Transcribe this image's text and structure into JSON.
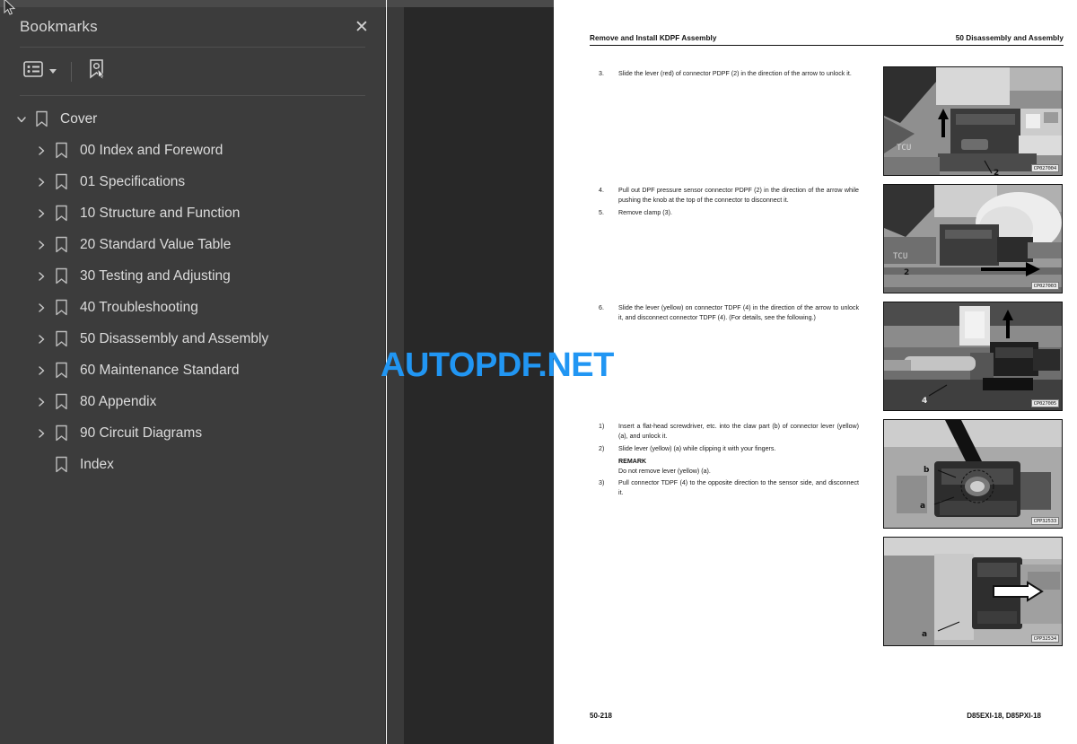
{
  "sidebar": {
    "title": "Bookmarks",
    "close_label": "✕",
    "toolbar": {
      "options_icon": "list-options-icon",
      "expand_caret": "chevron-down-icon",
      "new_bookmark_icon": "new-bookmark-icon"
    },
    "tree": [
      {
        "label": "Cover",
        "level": 0,
        "expanded": true,
        "has_children": true
      },
      {
        "label": "00 Index and Foreword",
        "level": 1,
        "expanded": false,
        "has_children": true
      },
      {
        "label": "01 Specifications",
        "level": 1,
        "expanded": false,
        "has_children": true
      },
      {
        "label": "10 Structure and Function",
        "level": 1,
        "expanded": false,
        "has_children": true
      },
      {
        "label": "20 Standard Value Table",
        "level": 1,
        "expanded": false,
        "has_children": true
      },
      {
        "label": "30 Testing and Adjusting",
        "level": 1,
        "expanded": false,
        "has_children": true
      },
      {
        "label": "40 Troubleshooting",
        "level": 1,
        "expanded": false,
        "has_children": true
      },
      {
        "label": "50 Disassembly and Assembly",
        "level": 1,
        "expanded": false,
        "has_children": true
      },
      {
        "label": "60 Maintenance Standard",
        "level": 1,
        "expanded": false,
        "has_children": true
      },
      {
        "label": "80 Appendix",
        "level": 1,
        "expanded": false,
        "has_children": true
      },
      {
        "label": "90 Circuit Diagrams",
        "level": 1,
        "expanded": false,
        "has_children": true
      },
      {
        "label": "Index",
        "level": 1,
        "expanded": false,
        "has_children": false
      }
    ]
  },
  "watermark": {
    "text": "AUTOPDF.NET",
    "color": "#2196f3"
  },
  "document": {
    "header": {
      "left": "Remove and Install KDPF Assembly",
      "right": "50 Disassembly and Assembly"
    },
    "footer": {
      "left": "50-218",
      "right": "D85EXI-18, D85PXI-18"
    },
    "blocks": [
      {
        "id": "step-3",
        "steps": [
          {
            "num": "3.",
            "text": "Slide the lever (red) of connector PDPF (2) in the direction of the arrow to unlock it."
          }
        ]
      },
      {
        "id": "step-4-5",
        "steps": [
          {
            "num": "4.",
            "text": "Pull out DPF pressure sensor connector PDPF (2) in the direction of the arrow while pushing the knob at the top of the connector to disconnect it."
          },
          {
            "num": "5.",
            "text": "Remove clamp (3)."
          }
        ]
      },
      {
        "id": "step-6",
        "steps": [
          {
            "num": "6.",
            "text": "Slide the lever (yellow) on connector TDPF (4) in the direction of the arrow to unlock it, and disconnect connector TDPF (4). (For details, see the following.)"
          }
        ]
      },
      {
        "id": "step-sub",
        "steps": [
          {
            "num": "1)",
            "text": "Insert a flat-head screwdriver, etc. into the claw part (b) of connector lever (yellow) (a), and unlock it."
          },
          {
            "num": "2)",
            "text": "Slide lever (yellow) (a) while clipping it with your fingers."
          }
        ],
        "remark_title": "REMARK",
        "remark_body": "Do not remove lever (yellow) (a).",
        "steps_after": [
          {
            "num": "3)",
            "text": "Pull connector TDPF (4) to the opposite direction to the sensor side, and disconnect it."
          }
        ]
      }
    ],
    "figures": [
      {
        "code": "CP027004",
        "alt": "photo-connector-pdpf-lever"
      },
      {
        "code": "CP027003",
        "alt": "photo-pull-out-pdpf-connector"
      },
      {
        "code": "CP027005",
        "alt": "photo-connector-tdpf-lever"
      },
      {
        "code": "CPP32533",
        "alt": "photo-screwdriver-claw-part"
      },
      {
        "code": "CPP32534",
        "alt": "photo-pull-connector-tdpf"
      }
    ]
  }
}
